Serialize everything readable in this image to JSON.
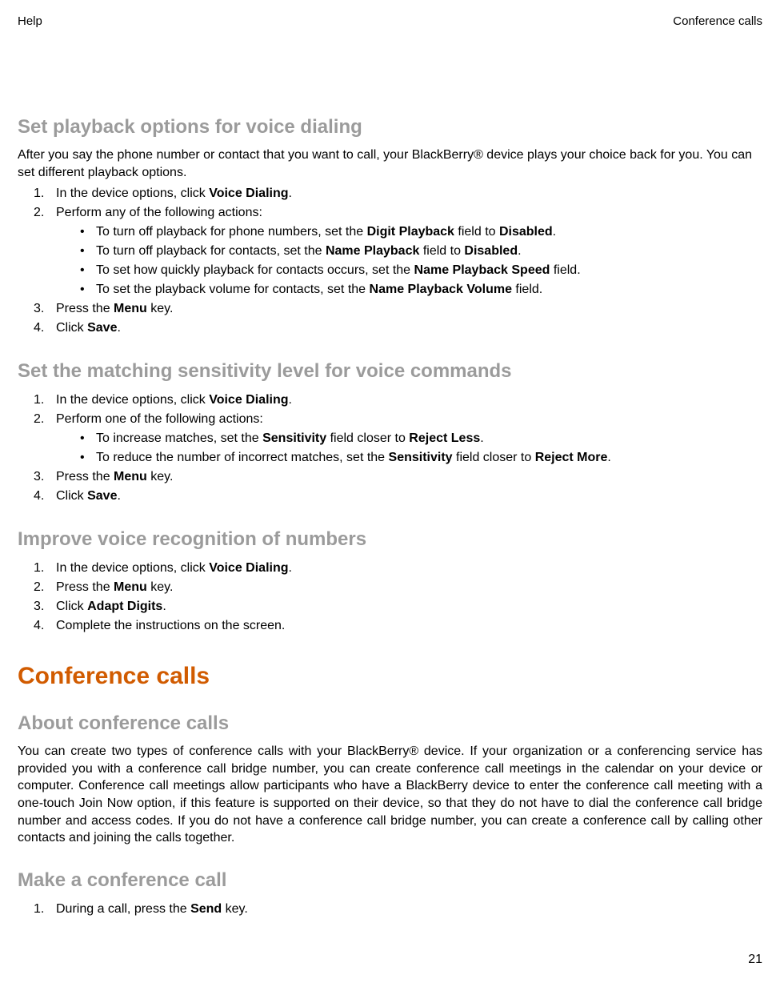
{
  "header": {
    "left": "Help",
    "right": "Conference calls"
  },
  "section1": {
    "heading": "Set playback options for voice dialing",
    "intro": "After you say the phone number or contact that you want to call, your BlackBerry® device plays your choice back for you. You can set different playback options.",
    "step1_pre": "In the device options, click ",
    "step1_bold": "Voice Dialing",
    "step1_post": ".",
    "step2": "Perform any of the following actions:",
    "bullet1_pre": "To turn off playback for phone numbers, set the ",
    "bullet1_b1": "Digit Playback",
    "bullet1_mid": " field to ",
    "bullet1_b2": "Disabled",
    "bullet1_post": ".",
    "bullet2_pre": "To turn off playback for contacts, set the ",
    "bullet2_b1": "Name Playback",
    "bullet2_mid": " field to ",
    "bullet2_b2": "Disabled",
    "bullet2_post": ".",
    "bullet3_pre": "To set how quickly playback for contacts occurs, set the ",
    "bullet3_b1": "Name Playback Speed",
    "bullet3_post": " field.",
    "bullet4_pre": "To set the playback volume for contacts, set the ",
    "bullet4_b1": "Name Playback Volume",
    "bullet4_post": " field.",
    "step3_pre": "Press the ",
    "step3_bold": "Menu",
    "step3_post": " key.",
    "step4_pre": "Click ",
    "step4_bold": "Save",
    "step4_post": "."
  },
  "section2": {
    "heading": "Set the matching sensitivity level for voice commands",
    "step1_pre": "In the device options, click ",
    "step1_bold": "Voice Dialing",
    "step1_post": ".",
    "step2": "Perform one of the following actions:",
    "bullet1_pre": "To increase matches, set the ",
    "bullet1_b1": "Sensitivity",
    "bullet1_mid": " field closer to ",
    "bullet1_b2": "Reject Less",
    "bullet1_post": ".",
    "bullet2_pre": "To reduce the number of incorrect matches, set the ",
    "bullet2_b1": "Sensitivity",
    "bullet2_mid": " field closer to ",
    "bullet2_b2": "Reject More",
    "bullet2_post": ".",
    "step3_pre": "Press the ",
    "step3_bold": "Menu",
    "step3_post": " key.",
    "step4_pre": "Click ",
    "step4_bold": "Save",
    "step4_post": "."
  },
  "section3": {
    "heading": "Improve voice recognition of numbers",
    "step1_pre": "In the device options, click ",
    "step1_bold": "Voice Dialing",
    "step1_post": ".",
    "step2_pre": "Press the ",
    "step2_bold": "Menu",
    "step2_post": " key.",
    "step3_pre": "Click ",
    "step3_bold": "Adapt Digits",
    "step3_post": ".",
    "step4": "Complete the instructions on the screen."
  },
  "chapter": {
    "heading": "Conference calls"
  },
  "section4": {
    "heading": "About conference calls",
    "para": "You can create two types of conference calls with your BlackBerry® device. If your organization or a conferencing service has provided you with a conference call bridge number, you can create conference call meetings in the calendar on your device or computer. Conference call meetings allow participants who have a BlackBerry device to enter the conference call meeting with a one-touch Join Now option, if this feature is supported on their device, so that they do not have to dial the conference call bridge number and access codes. If you do not have a conference call bridge number, you can create a conference call by calling other contacts and joining the calls together."
  },
  "section5": {
    "heading": "Make a conference call",
    "step1_pre": "During a call, press the ",
    "step1_bold": "Send",
    "step1_post": " key."
  },
  "page_number": "21"
}
